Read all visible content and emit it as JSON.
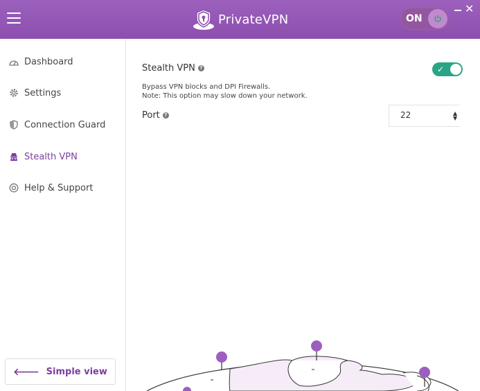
{
  "app": {
    "name": "PrivateVPN",
    "connection_status": "ON"
  },
  "sidebar": {
    "items": [
      {
        "label": "Dashboard",
        "icon": "dashboard-icon",
        "active": false
      },
      {
        "label": "Settings",
        "icon": "gear-icon",
        "active": false
      },
      {
        "label": "Connection Guard",
        "icon": "shield-icon",
        "active": false
      },
      {
        "label": "Stealth VPN",
        "icon": "incognito-icon",
        "active": true
      },
      {
        "label": "Help & Support",
        "icon": "help-icon",
        "active": false
      }
    ],
    "simple_view_label": "Simple view"
  },
  "stealth": {
    "title": "Stealth VPN",
    "enabled": true,
    "description_line1": "Bypass VPN blocks and DPI Firewalls.",
    "description_line2": "Note: This option may slow down your network."
  },
  "port": {
    "label": "Port",
    "value": "22"
  },
  "colors": {
    "header_purple": "#8c4fae",
    "accent_purple": "#7c3f9e",
    "toggle_green": "#2aa485"
  }
}
